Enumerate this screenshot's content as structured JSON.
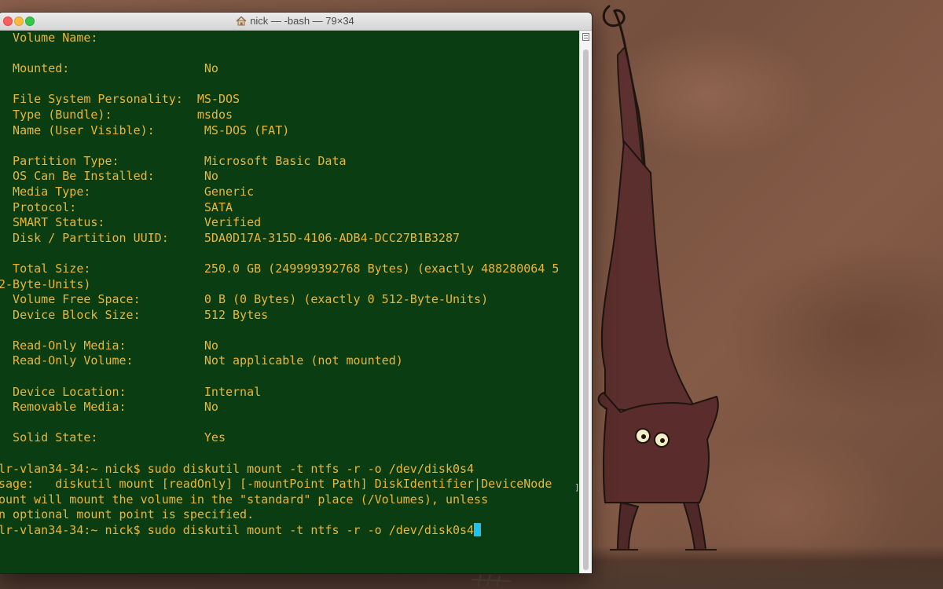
{
  "window": {
    "title": "nick — -bash — 79×34"
  },
  "terminal": {
    "lines": [
      "  Volume Name:",
      "",
      "  Mounted:                   No",
      "",
      "  File System Personality:  MS-DOS",
      "  Type (Bundle):            msdos",
      "  Name (User Visible):       MS-DOS (FAT)",
      "",
      "  Partition Type:            Microsoft Basic Data",
      "  OS Can Be Installed:       No",
      "  Media Type:                Generic",
      "  Protocol:                  SATA",
      "  SMART Status:              Verified",
      "  Disk / Partition UUID:     5DA0D17A-315D-4106-ADB4-DCC27B1B3287",
      "",
      "  Total Size:                250.0 GB (249999392768 Bytes) (exactly 488280064 5",
      "2-Byte-Units)",
      "  Volume Free Space:         0 B (0 Bytes) (exactly 0 512-Byte-Units)",
      "  Device Block Size:         512 Bytes",
      "",
      "  Read-Only Media:           No",
      "  Read-Only Volume:          Not applicable (not mounted)",
      "",
      "  Device Location:           Internal",
      "  Removable Media:           No",
      "",
      "  Solid State:               Yes",
      "",
      "lr-vlan34-34:~ nick$ sudo diskutil mount -t ntfs -r -o /dev/disk0s4",
      "sage:   diskutil mount [readOnly] [-mountPoint Path] DiskIdentifier|DeviceNode",
      "ount will mount the volume in the \"standard\" place (/Volumes), unless",
      "n optional mount point is specified."
    ],
    "prompt_line": "lr-vlan34-34:~ nick$ sudo diskutil mount -t ntfs -r -o /dev/disk0s4",
    "bracket_mark": "]"
  },
  "colors": {
    "terminal_background": "#0b3d12",
    "terminal_text": "#e7b63c",
    "cursor": "#22c1ec"
  }
}
